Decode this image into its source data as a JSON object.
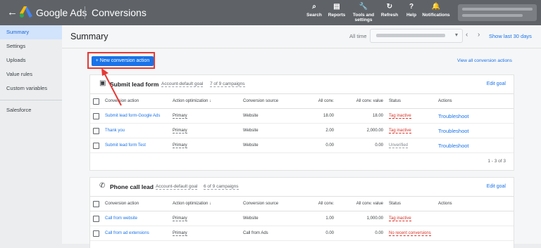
{
  "header": {
    "back_icon": "arrow-left-icon",
    "brand": "Google Ads",
    "page_title": "Conversions",
    "tools": [
      {
        "label": "Search",
        "icon": "search-icon",
        "glyph": "⌕"
      },
      {
        "label": "Reports",
        "icon": "reports-icon",
        "glyph": "▤"
      },
      {
        "label": "Tools and settings",
        "icon": "wrench-icon",
        "glyph": "🔧"
      },
      {
        "label": "Refresh",
        "icon": "refresh-icon",
        "glyph": "↻"
      },
      {
        "label": "Help",
        "icon": "help-icon",
        "glyph": "?"
      },
      {
        "label": "Notifications",
        "icon": "bell-icon",
        "glyph": "🔔"
      }
    ]
  },
  "sidebar": {
    "items": [
      "Summary",
      "Settings",
      "Uploads",
      "Value rules",
      "Custom variables"
    ],
    "secondary": [
      "Salesforce"
    ]
  },
  "main": {
    "title": "Summary",
    "all_time": "All time",
    "show_last": "Show last 30 days",
    "new_button": "+ New conversion action",
    "view_all": "View all conversion actions"
  },
  "cards": [
    {
      "icon": "form-icon",
      "title": "Submit lead form",
      "goal": "Account-default goal",
      "campaigns": "7 of 9 campaigns",
      "edit": "Edit goal",
      "columns": [
        "Conversion action",
        "Action optimization ↓",
        "Conversion source",
        "All conv.",
        "All conv. value",
        "Status",
        "Actions"
      ],
      "rows": [
        [
          "Submit lead form-Google Ads",
          "Primary",
          "Website",
          "18.00",
          "18.00",
          "Tag inactive",
          "Troubleshoot"
        ],
        [
          "Thank you",
          "Primary",
          "Website",
          "2.00",
          "2,000.00",
          "Tag inactive",
          "Troubleshoot"
        ],
        [
          "Submit lead form Test",
          "Primary",
          "Website",
          "0.00",
          "0.00",
          "Unverified",
          "Troubleshoot"
        ]
      ],
      "pager": "1 - 3 of 3"
    },
    {
      "icon": "phone-icon",
      "title": "Phone call lead",
      "goal": "Account-default goal",
      "campaigns": "6 of 9 campaigns",
      "edit": "Edit goal",
      "columns": [
        "Conversion action",
        "Action optimization ↓",
        "Conversion source",
        "All conv.",
        "All conv. value",
        "Status",
        "Actions"
      ],
      "rows": [
        [
          "Call from website",
          "Primary",
          "Website",
          "1.00",
          "1,000.00",
          "Tag inactive",
          ""
        ],
        [
          "Call from ad extensions",
          "Primary",
          "Call from Ads",
          "0.00",
          "0.00",
          "No recent conversions",
          ""
        ]
      ]
    }
  ],
  "colors": {
    "accent": "#1a73e8",
    "header": "#5f6368",
    "highlight": "#e53935",
    "status_red": "#d93025"
  }
}
